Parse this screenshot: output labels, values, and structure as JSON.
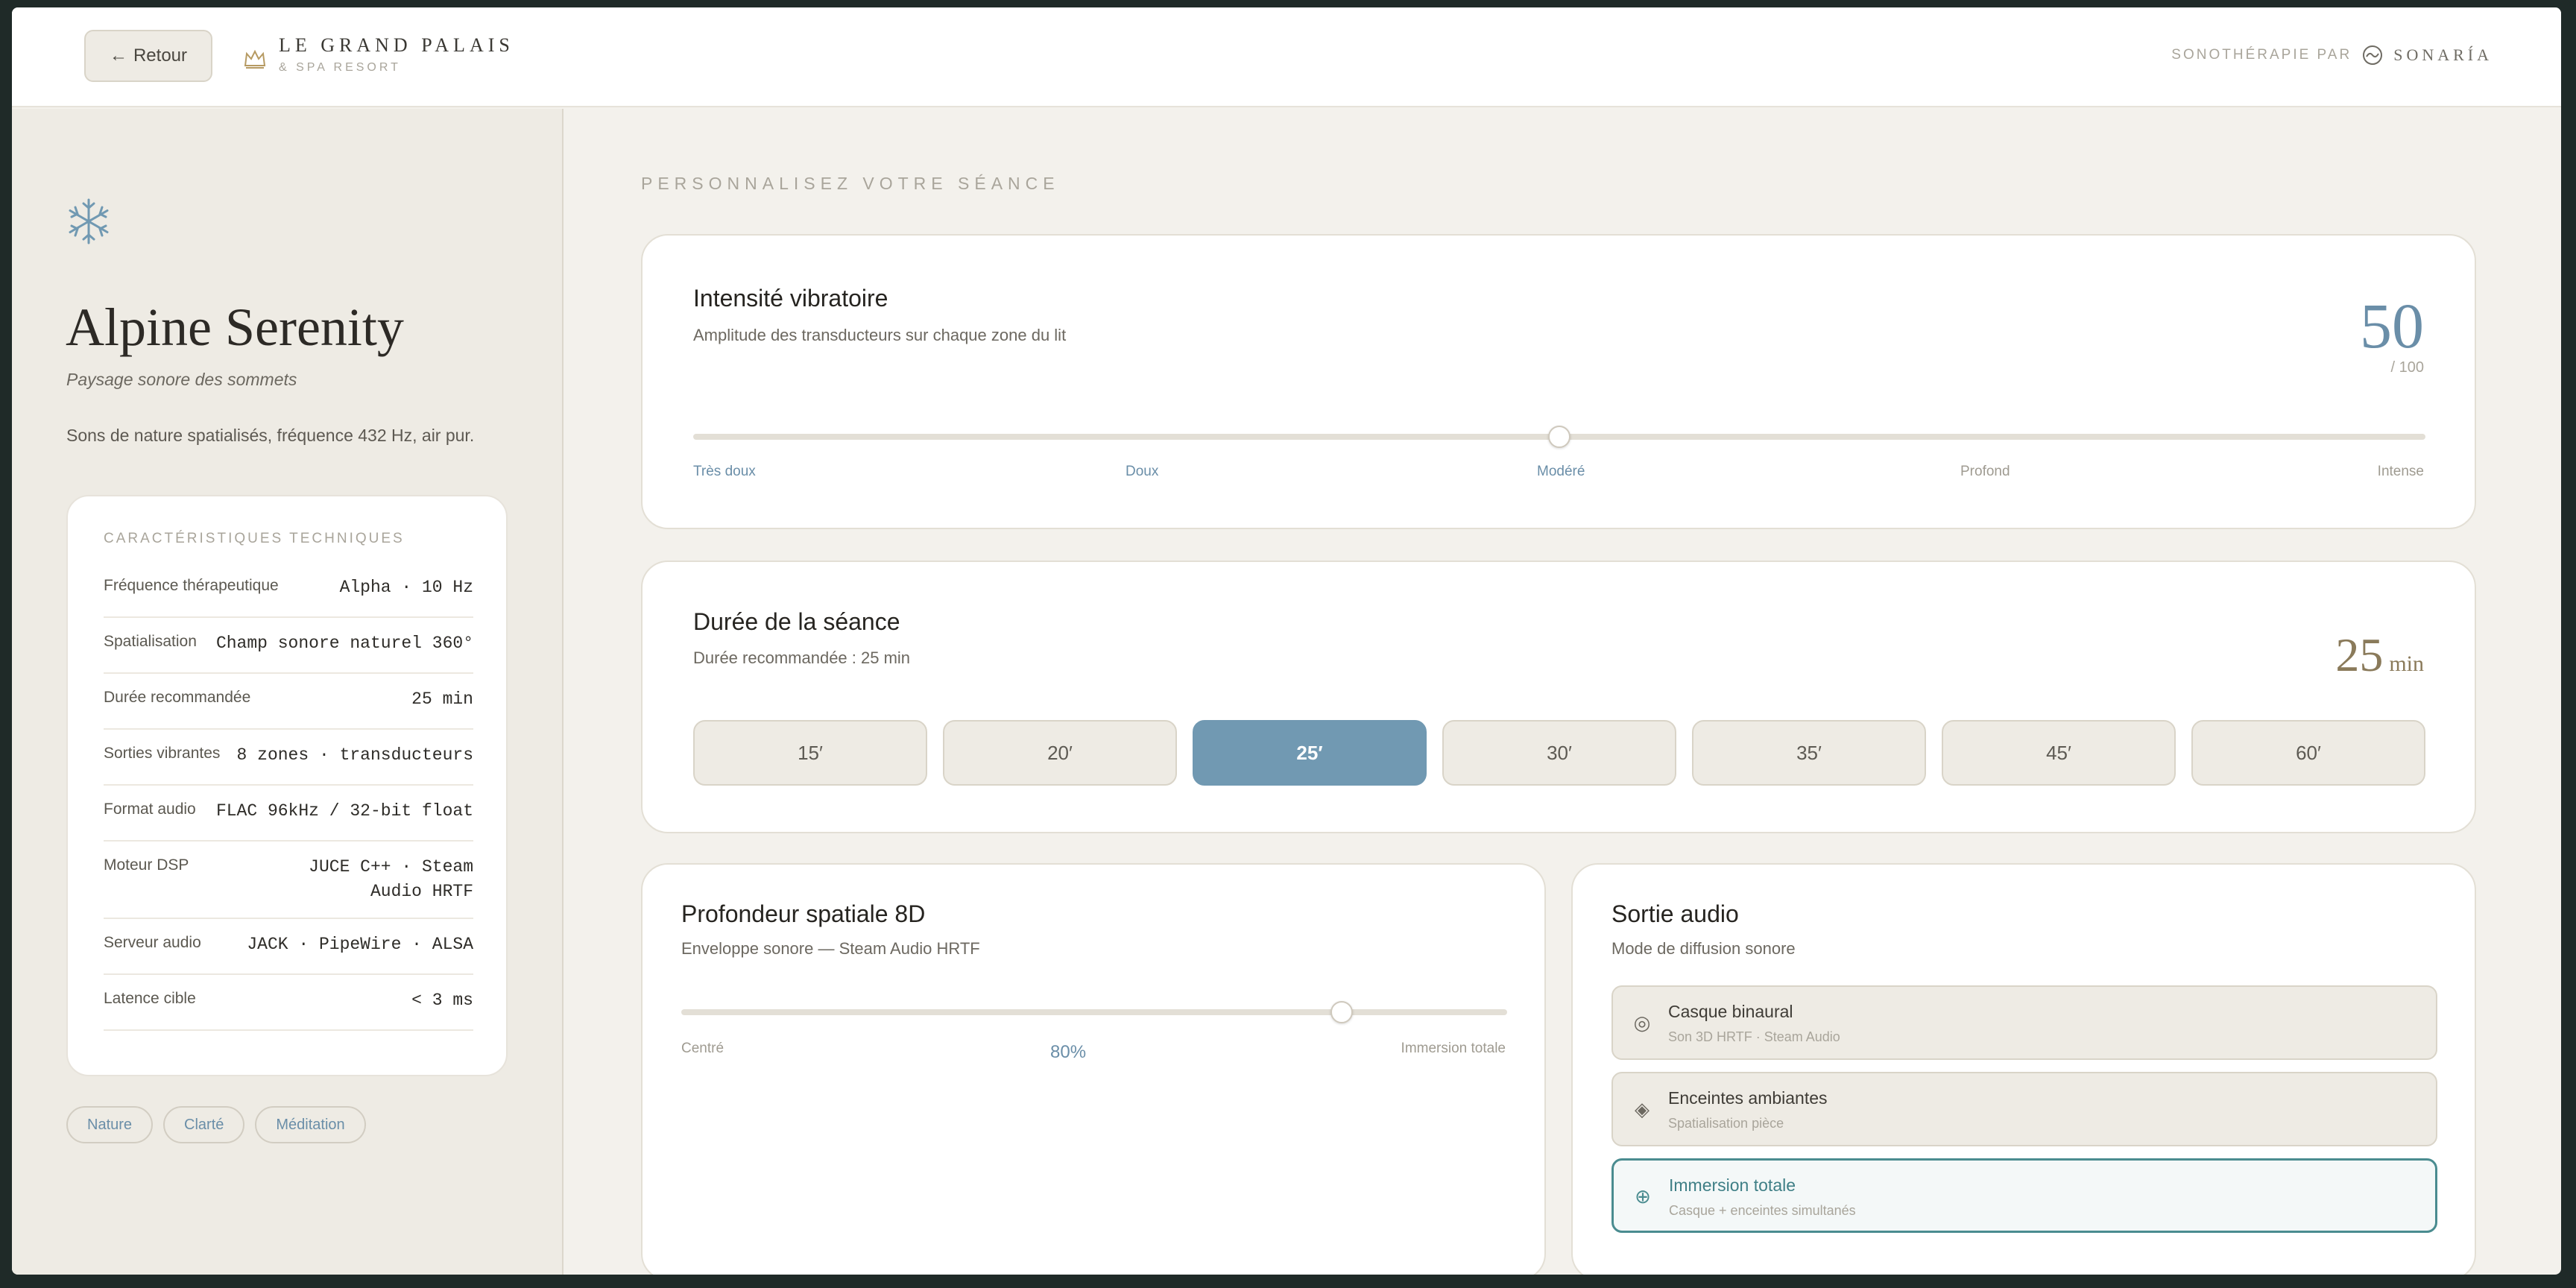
{
  "header": {
    "back_label": "Retour",
    "brand_name": "LE GRAND PALAIS",
    "brand_sub": "& SPA RESORT",
    "partner_prefix": "SONOTHÉRAPIE PAR",
    "partner_name": "SONARÍA"
  },
  "sidebar": {
    "icon": "snowflake-icon",
    "title": "Alpine Serenity",
    "subtitle": "Paysage sonore des sommets",
    "description": "Sons de nature spatialisés, fréquence 432 Hz, air pur.",
    "tech_title": "CARACTÉRISTIQUES TECHNIQUES",
    "tech": [
      {
        "key": "Fréquence thérapeutique",
        "value": "Alpha · 10 Hz"
      },
      {
        "key": "Spatialisation",
        "value": "Champ sonore naturel 360°"
      },
      {
        "key": "Durée recommandée",
        "value": "25 min"
      },
      {
        "key": "Sorties vibrantes",
        "value": "8 zones · transducteurs"
      },
      {
        "key": "Format audio",
        "value": "FLAC 96kHz / 32-bit float"
      },
      {
        "key": "Moteur DSP",
        "value": "JUCE C++ · Steam Audio HRTF"
      },
      {
        "key": "Serveur audio",
        "value": "JACK · PipeWire · ALSA"
      },
      {
        "key": "Latence cible",
        "value": "< 3 ms"
      }
    ],
    "tags": [
      "Nature",
      "Clarté",
      "Méditation"
    ]
  },
  "main": {
    "section_label": "PERSONNALISEZ VOTRE SÉANCE",
    "intensity": {
      "title": "Intensité vibratoire",
      "subtitle": "Amplitude des transducteurs sur chaque zone du lit",
      "value": "50",
      "max": "/ 100",
      "level": 0.5,
      "scale": [
        "Très doux",
        "Doux",
        "Modéré",
        "Profond",
        "Intense"
      ]
    },
    "duration": {
      "title": "Durée de la séance",
      "subtitle": "Durée recommandée : 25 min",
      "value": "25",
      "unit": "min",
      "options": [
        "15′",
        "20′",
        "25′",
        "30′",
        "35′",
        "45′",
        "60′"
      ],
      "selected": "25′"
    },
    "depth": {
      "title": "Profondeur spatiale 8D",
      "subtitle": "Enveloppe sonore — Steam Audio HRTF",
      "min_label": "Centré",
      "max_label": "Immersion totale",
      "value_label": "80%",
      "level": 0.8
    },
    "output": {
      "title": "Sortie audio",
      "subtitle": "Mode de diffusion sonore",
      "options": [
        {
          "name": "Casque binaural",
          "desc": "Son 3D HRTF · Steam Audio",
          "icon": "headphones-icon"
        },
        {
          "name": "Enceintes ambiantes",
          "desc": "Spatialisation pièce",
          "icon": "speaker-diamond-icon"
        },
        {
          "name": "Immersion totale",
          "desc": "Casque + enceintes simultanés",
          "icon": "circle-plus-icon"
        }
      ],
      "selected": "Immersion totale"
    }
  },
  "colors": {
    "accent": "#6a8ea8",
    "selected_button": "#7199b2",
    "selected_output": "#4a8c90",
    "gold": "#8a7a5a"
  }
}
